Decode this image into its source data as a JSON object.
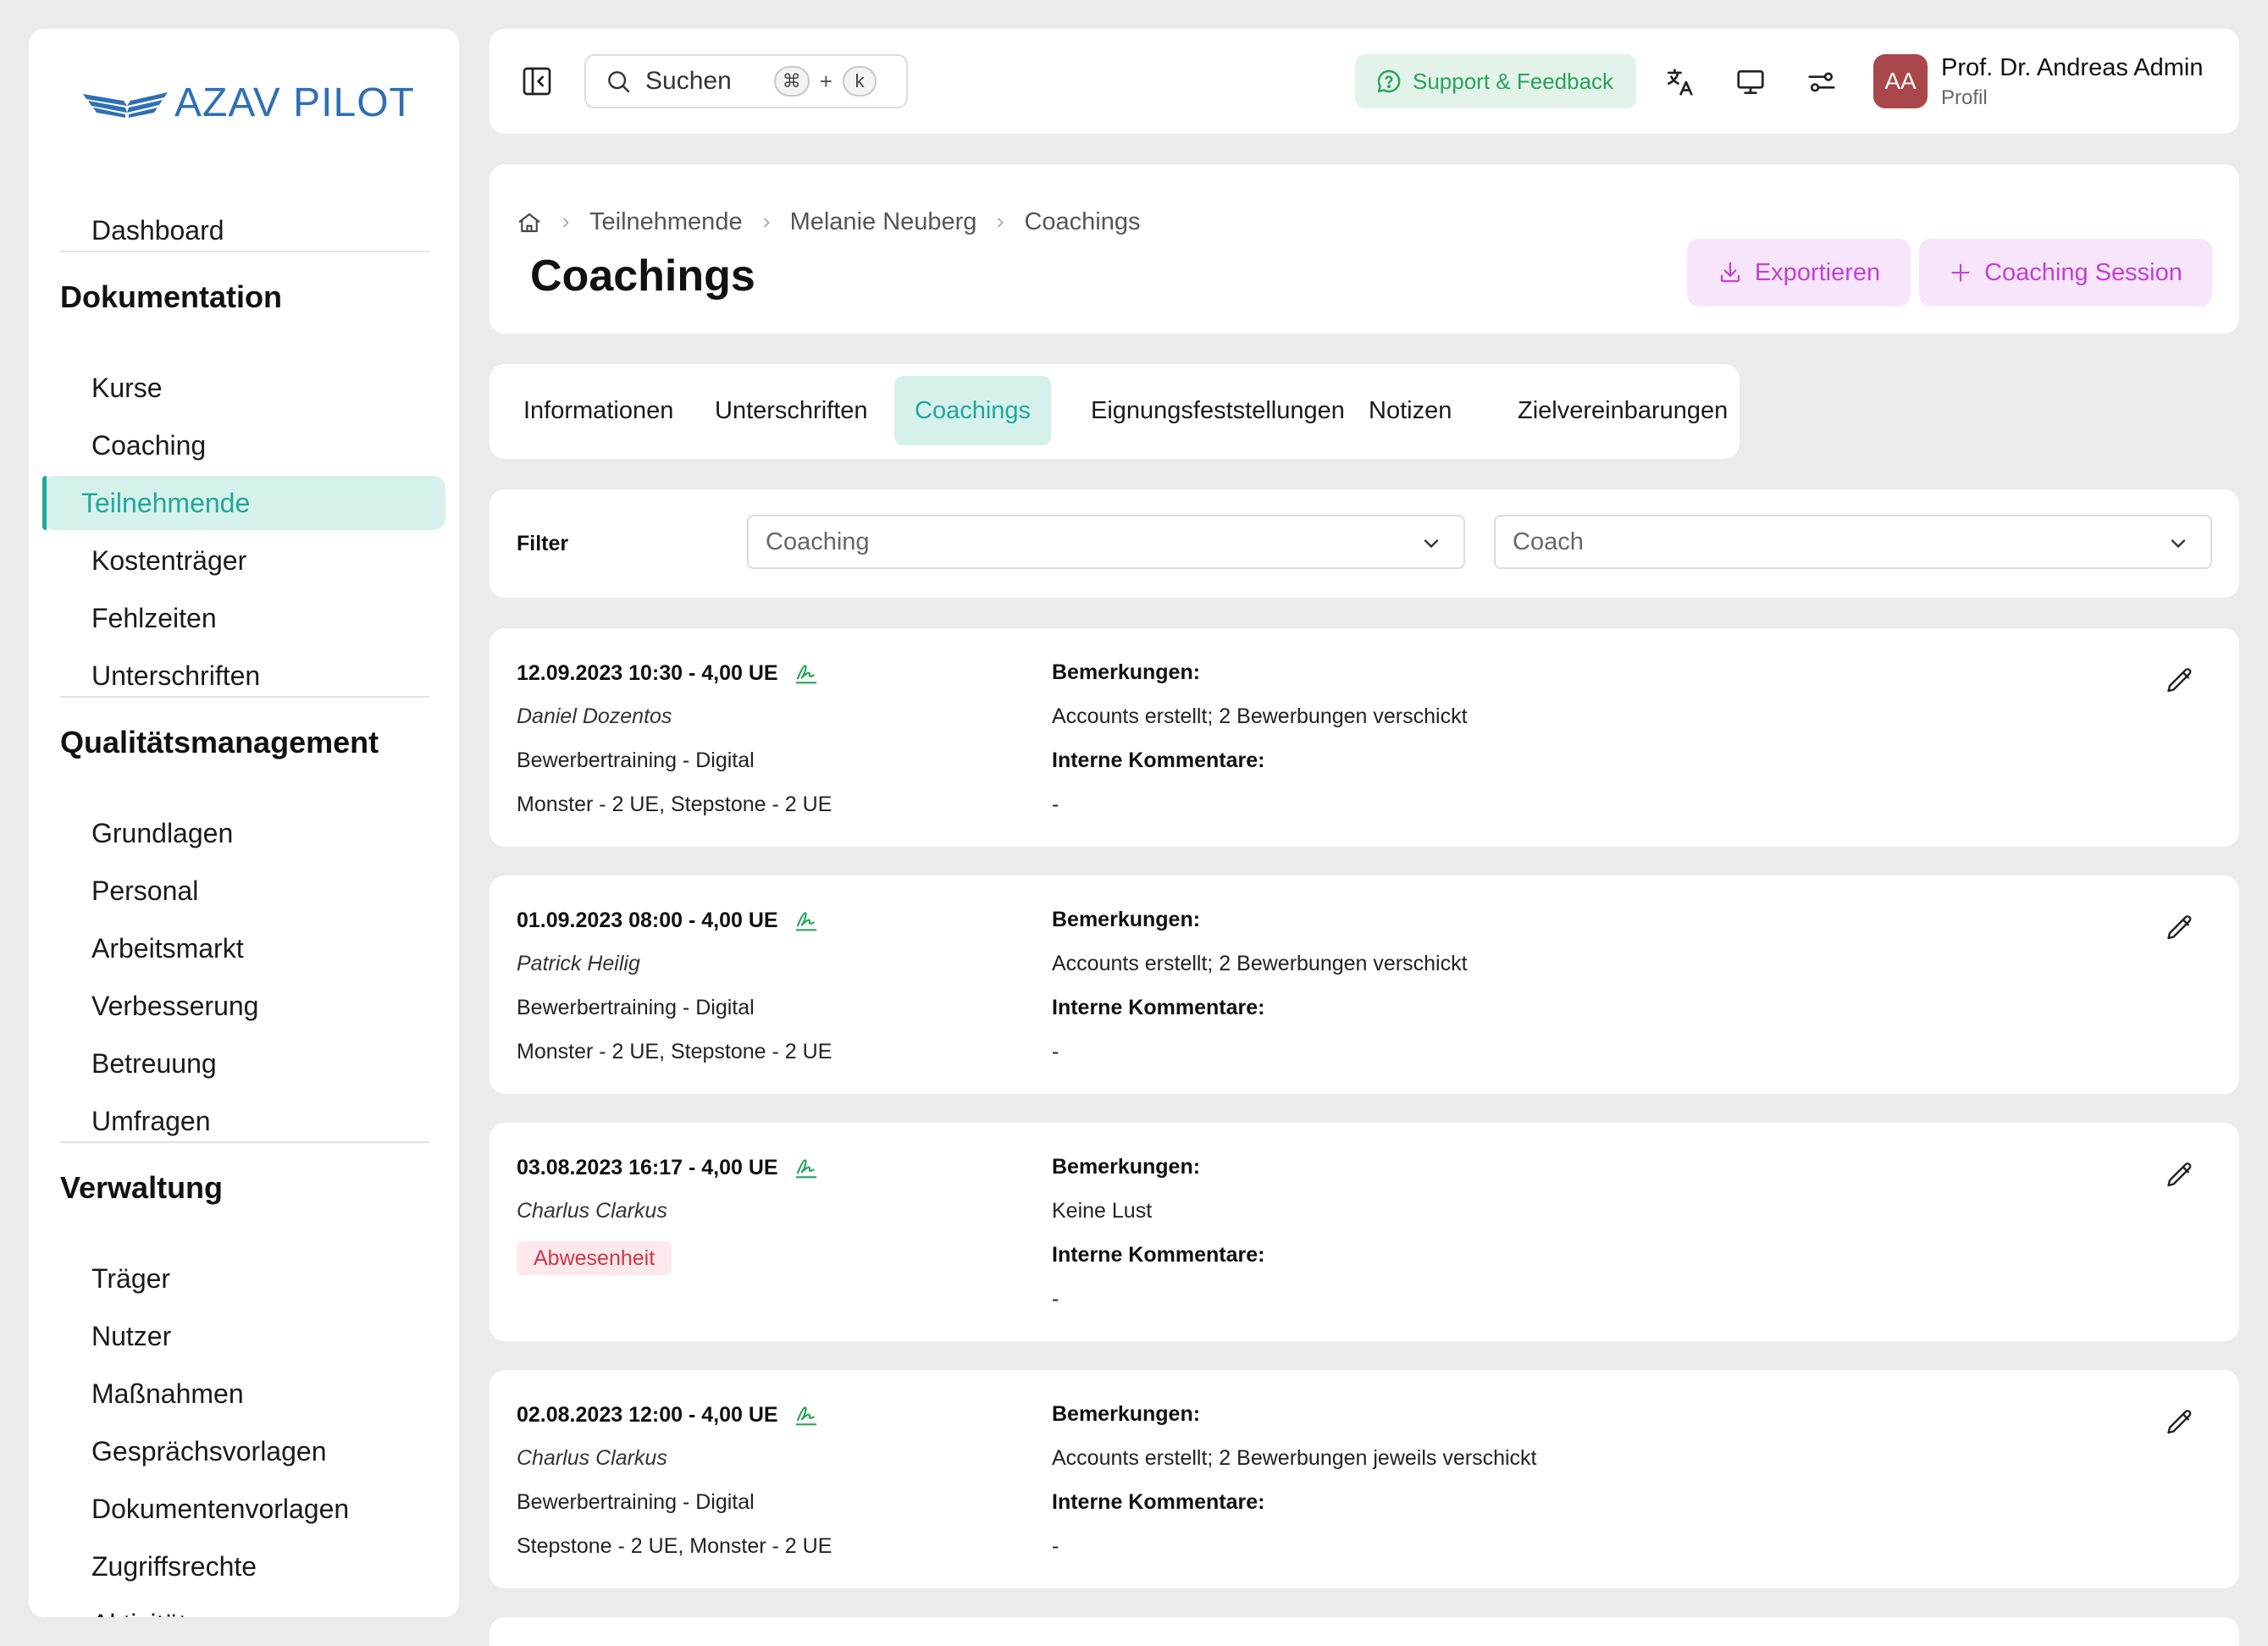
{
  "app": {
    "logo_text": "AZAV PILOT",
    "brand_color": "#2f6fb5",
    "accent_color": "#1fa898"
  },
  "sidebar": {
    "top_item": "Dashboard",
    "sections": [
      {
        "title": "Dokumentation",
        "items": [
          "Kurse",
          "Coaching",
          "Teilnehmende",
          "Kostenträger",
          "Fehlzeiten",
          "Unterschriften"
        ]
      },
      {
        "title": "Qualitätsmanagement",
        "items": [
          "Grundlagen",
          "Personal",
          "Arbeitsmarkt",
          "Verbesserung",
          "Betreuung",
          "Umfragen"
        ]
      },
      {
        "title": "Verwaltung",
        "items": [
          "Träger",
          "Nutzer",
          "Maßnahmen",
          "Gesprächsvorlagen",
          "Dokumentenvorlagen",
          "Zugriffsrechte",
          "Aktivität"
        ]
      }
    ],
    "active_item": "Teilnehmende"
  },
  "topbar": {
    "search_label": "Suchen",
    "shortcut_key_1": "⌘",
    "shortcut_plus": "+",
    "shortcut_key_2": "k",
    "support_label": "Support & Feedback",
    "icons": [
      "sidebar-toggle-icon",
      "translate-icon",
      "monitor-icon",
      "settings-sliders-icon"
    ],
    "user": {
      "initials": "AA",
      "name": "Prof. Dr. Andreas Admin",
      "subtitle": "Profil"
    }
  },
  "header": {
    "breadcrumb": [
      "Teilnehmende",
      "Melanie Neuberg",
      "Coachings"
    ],
    "title": "Coachings",
    "export_label": "Exportieren",
    "add_session_label": "Coaching Session"
  },
  "tabs": [
    "Informationen",
    "Unterschriften",
    "Coachings",
    "Eignungsfeststellungen",
    "Notizen",
    "Zielvereinbarungen"
  ],
  "active_tab": "Coachings",
  "filter": {
    "label": "Filter",
    "coaching_placeholder": "Coaching",
    "coach_placeholder": "Coach"
  },
  "sessions": [
    {
      "datetime": "12.09.2023 10:30 - 4,00 UE",
      "coach": "Daniel Dozentos",
      "type": "Bewerbertraining - Digital",
      "details": "Monster - 2 UE, Stepstone - 2 UE",
      "remarks_label": "Bemerkungen:",
      "remarks": "Accounts erstellt; 2 Bewerbungen verschickt",
      "internal_label": "Interne Kommentare:",
      "internal": "-"
    },
    {
      "datetime": "01.09.2023 08:00 - 4,00 UE",
      "coach": "Patrick Heilig",
      "type": "Bewerbertraining - Digital",
      "details": "Monster - 2 UE, Stepstone - 2 UE",
      "remarks_label": "Bemerkungen:",
      "remarks": "Accounts erstellt; 2 Bewerbungen verschickt",
      "internal_label": "Interne Kommentare:",
      "internal": "-"
    },
    {
      "datetime": "03.08.2023 16:17 - 4,00 UE",
      "coach": "Charlus Clarkus",
      "badge": "Abwesenheit",
      "remarks_label": "Bemerkungen:",
      "remarks": "Keine Lust",
      "internal_label": "Interne Kommentare:",
      "internal": "-"
    },
    {
      "datetime": "02.08.2023 12:00 - 4,00 UE",
      "coach": "Charlus Clarkus",
      "type": "Bewerbertraining - Digital",
      "details": "Stepstone - 2 UE, Monster - 2 UE",
      "remarks_label": "Bemerkungen:",
      "remarks": "Accounts erstellt; 2 Bewerbungen jeweils verschickt",
      "internal_label": "Interne Kommentare:",
      "internal": "-"
    }
  ]
}
